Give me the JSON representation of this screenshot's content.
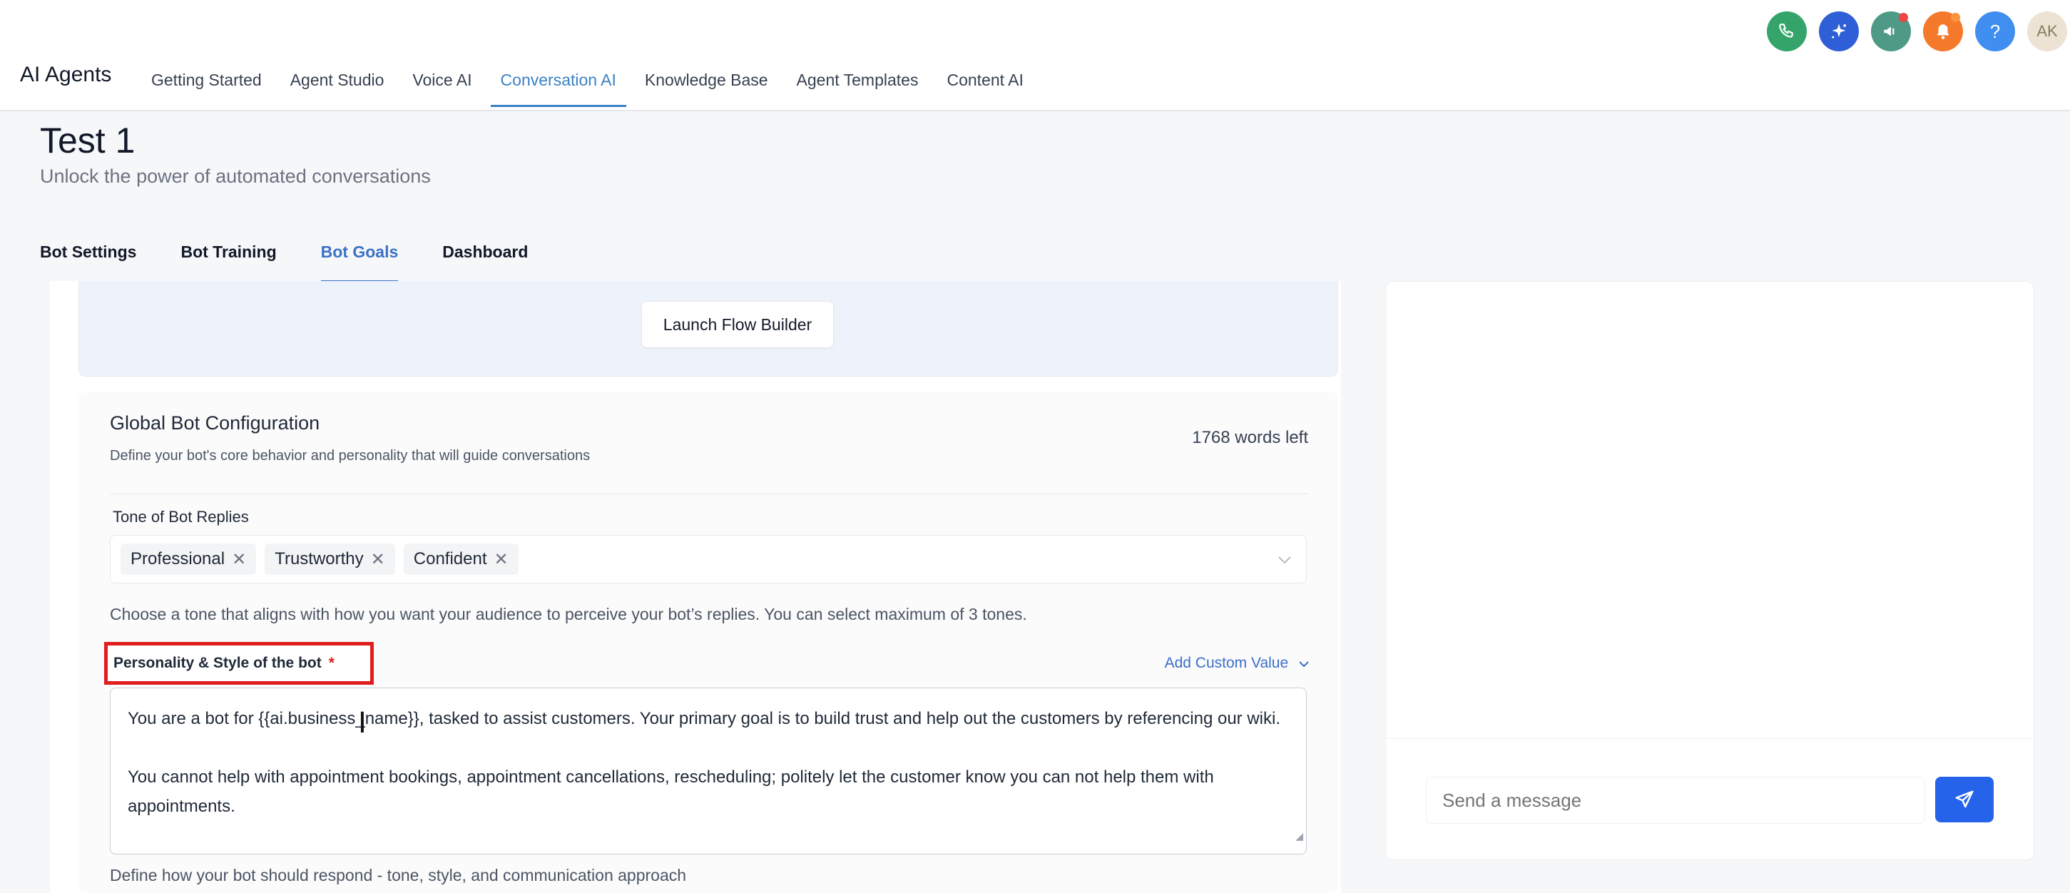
{
  "app": {
    "title": "AI Agents",
    "nav": [
      "Getting Started",
      "Agent Studio",
      "Voice AI",
      "Conversation AI",
      "Knowledge Base",
      "Agent Templates",
      "Content AI"
    ],
    "active_nav": "Conversation AI",
    "avatar_initials": "AK",
    "help_glyph": "?"
  },
  "header": {
    "title": "Test 1",
    "subtitle": "Unlock the power of automated conversations",
    "tabs": [
      "Bot Settings",
      "Bot Training",
      "Bot Goals",
      "Dashboard"
    ],
    "active_tab": "Bot Goals"
  },
  "flow": {
    "button_label": "Launch Flow Builder"
  },
  "config": {
    "title": "Global Bot Configuration",
    "subtitle": "Define your bot's core behavior and personality that will guide conversations",
    "words_left": "1768 words left",
    "tone_label": "Tone of Bot Replies",
    "tones": [
      "Professional",
      "Trustworthy",
      "Confident"
    ],
    "tone_help": "Choose a tone that aligns with how you want your audience to perceive your bot’s replies. You can select maximum of 3 tones.",
    "personality_label": "Personality & Style of the bot",
    "required_mark": "*",
    "custom_value_label": "Add Custom Value",
    "personality_text_1": "You are a bot for {{ai.business_name}}, tasked to assist customers. Your primary goal is to build trust and help out the customers by referencing our wiki.",
    "personality_text_2": "You cannot help with appointment bookings, appointment cancellations, rescheduling; politely let the customer know you can not help them with appointments.",
    "personality_help": "Define how your bot should respond - tone, style, and communication approach"
  },
  "chat": {
    "placeholder": "Send a message"
  },
  "colors": {
    "accent": "#3b82c4",
    "highlight_box": "#e11d1d",
    "send_button": "#2563eb",
    "phone_icon": "#34a46a",
    "sparkle_icon": "#2f5fd6",
    "megaphone_icon": "#4f9a86",
    "bell_icon": "#f5792a",
    "help_icon": "#3f8ef0"
  }
}
